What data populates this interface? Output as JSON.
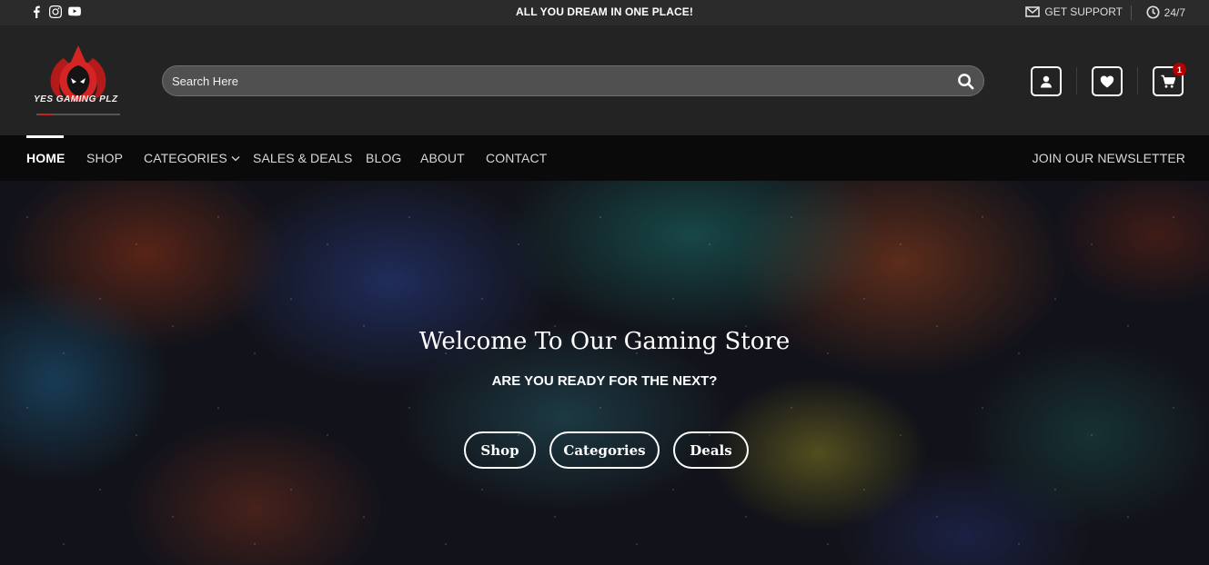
{
  "topbar": {
    "social_icons": [
      "facebook-icon",
      "instagram-icon",
      "youtube-icon"
    ],
    "promo": "ALL YOU DREAM IN ONE PLACE!",
    "support_label": "GET SUPPORT",
    "hours_label": "24/7"
  },
  "header": {
    "logo_text": "YES GAMING PLZ",
    "search_placeholder": "Search Here",
    "cart_count": "1",
    "accent_color": "#b30000"
  },
  "nav": {
    "items": [
      {
        "label": "HOME"
      },
      {
        "label": "SHOP"
      },
      {
        "label": "CATEGORIES"
      },
      {
        "label": "SALES & DEALS"
      },
      {
        "label": "BLOG"
      },
      {
        "label": "ABOUT"
      },
      {
        "label": "CONTACT"
      }
    ],
    "newsletter": "JOIN OUR NEWSLETTER"
  },
  "hero": {
    "title": "Welcome To Our Gaming Store",
    "subtitle": "ARE YOU READY FOR THE NEXT?",
    "buttons": [
      {
        "label": "Shop"
      },
      {
        "label": "Categories"
      },
      {
        "label": "Deals"
      }
    ]
  }
}
